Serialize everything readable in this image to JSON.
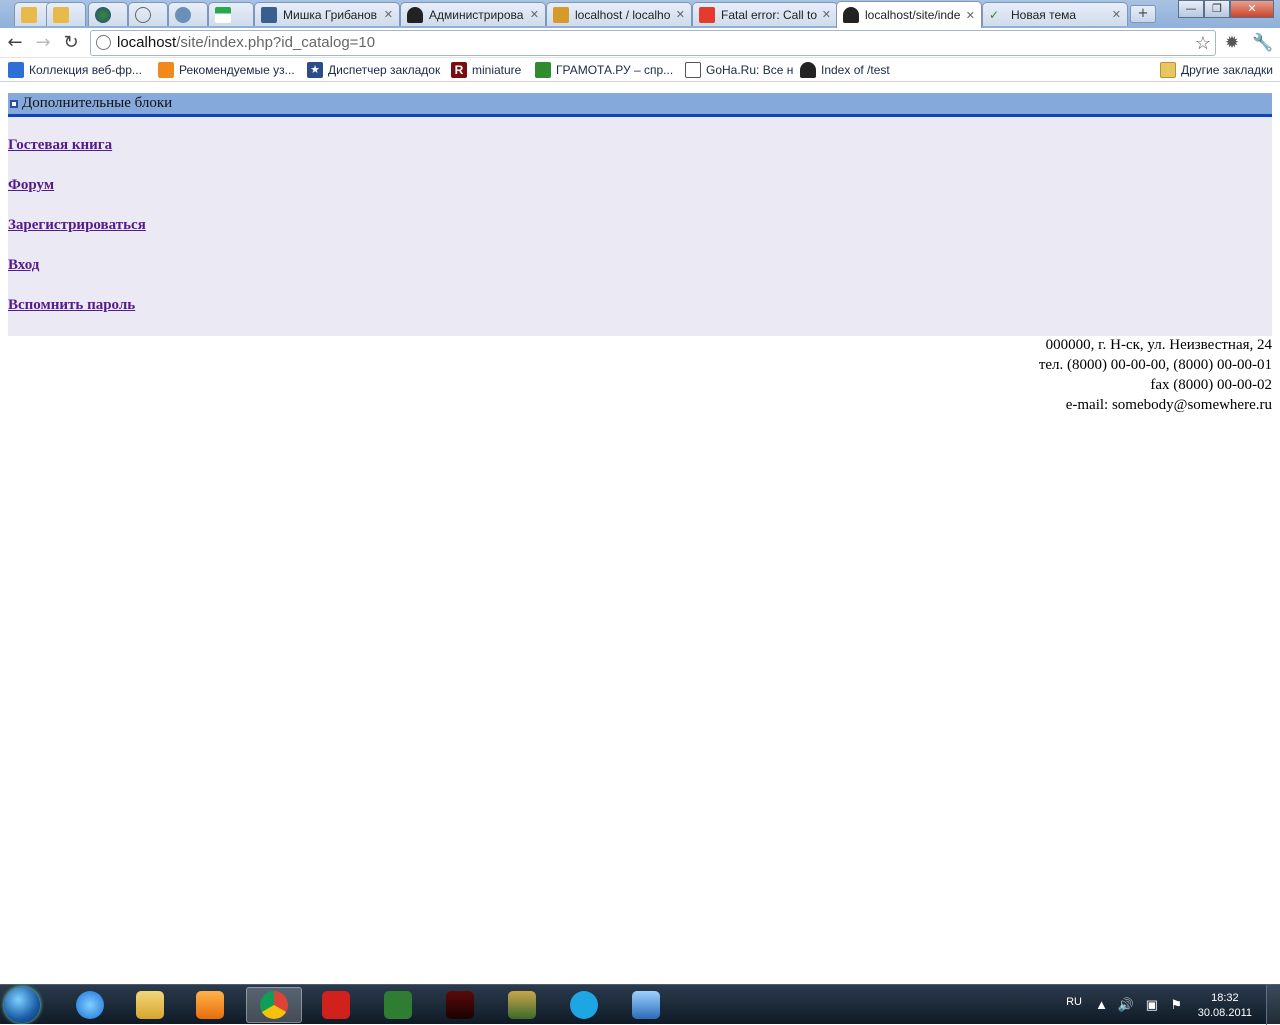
{
  "browser": {
    "tabs": [
      {
        "label": "",
        "icon": "app-favicon-icon"
      },
      {
        "label": "",
        "icon": "app-favicon-icon"
      },
      {
        "label": "",
        "icon": "globe-icon"
      },
      {
        "label": "",
        "icon": "globe-icon"
      },
      {
        "label": "",
        "icon": "gear-favicon-icon"
      },
      {
        "label": "",
        "icon": "t-favicon-icon"
      },
      {
        "label": "Мишка Грибанов",
        "icon": "video-icon"
      },
      {
        "label": "Администрирова",
        "icon": "spy-icon"
      },
      {
        "label": "localhost / localho",
        "icon": "pma-icon"
      },
      {
        "label": "Fatal error: Call to",
        "icon": "yandex-icon"
      },
      {
        "label": "localhost/site/inde",
        "icon": "spy-icon"
      },
      {
        "label": "Новая тема",
        "icon": "check-icon"
      }
    ],
    "new_tab": "+",
    "window_buttons": {
      "min": "—",
      "max": "❐",
      "close": "✕"
    },
    "address": {
      "host": "localhost",
      "path": "/site/index.php?id_catalog=10"
    },
    "bookmarks": [
      {
        "label": "Коллекция веб-фр...",
        "color": "#2e6fd6"
      },
      {
        "label": "Рекомендуемые уз...",
        "color": "#f08a1c"
      },
      {
        "label": "Диспетчер закладок",
        "color": "#2d4a8a"
      },
      {
        "label": "miniature",
        "color": "#7a0e0e"
      },
      {
        "label": "ГРАМОТА.РУ – спр...",
        "color": "#2e8b2e"
      },
      {
        "label": "GoHa.Ru: Все н",
        "color": "#555555"
      },
      {
        "label": "Index of /test",
        "color": "#222222"
      }
    ],
    "other_bookmarks": "Другие закладки"
  },
  "page": {
    "block_title": "Дополнительные блоки",
    "links": [
      "Гостевая книга",
      "Форум",
      "Зарегистрироваться",
      "Вход",
      "Вспомнить пароль"
    ],
    "address_lines": [
      "000000, г. Н-ск, ул. Неизвестная, 24",
      "тел. (8000) 00-00-00, (8000) 00-00-01",
      "fax (8000) 00-00-02",
      "e-mail: somebody@somewhere.ru"
    ]
  },
  "taskbar": {
    "language": "RU",
    "time": "18:32",
    "date": "30.08.2011",
    "apps": [
      "internet-explorer",
      "file-explorer",
      "media-player",
      "chrome",
      "comodo",
      "csharp",
      "game-dark",
      "shield-game",
      "skype",
      "misc-app"
    ]
  }
}
